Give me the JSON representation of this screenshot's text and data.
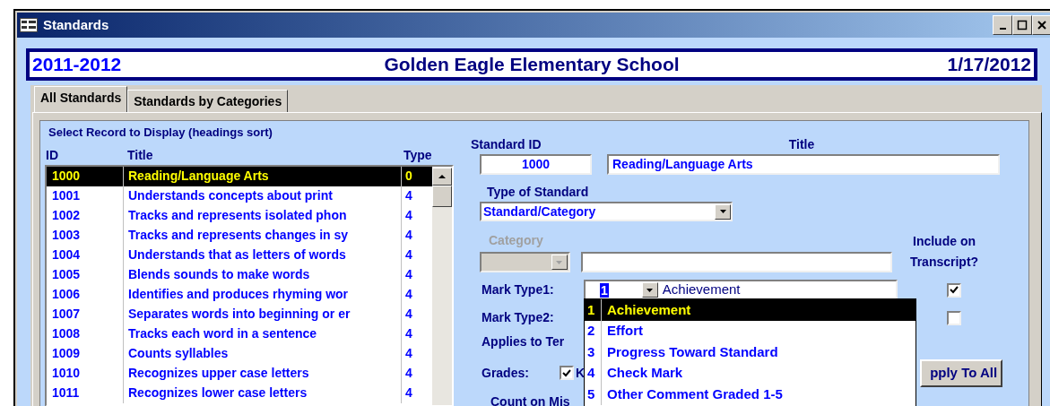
{
  "window": {
    "title": "Standards"
  },
  "header": {
    "year": "2011-2012",
    "school": "Golden Eagle Elementary School",
    "date": "1/17/2012"
  },
  "tabs": [
    {
      "label": "All Standards",
      "selected": true
    },
    {
      "label": "Standards by Categories",
      "selected": false
    }
  ],
  "record_list": {
    "caption": "Select Record to Display (headings sort)",
    "columns": [
      "ID",
      "Title",
      "Type"
    ],
    "rows": [
      {
        "id": "1000",
        "title": "Reading/Language Arts",
        "type": "0",
        "selected": true
      },
      {
        "id": "1001",
        "title": "Understands concepts about print",
        "type": "4",
        "selected": false
      },
      {
        "id": "1002",
        "title": "Tracks and represents isolated phon",
        "type": "4",
        "selected": false
      },
      {
        "id": "1003",
        "title": "Tracks and represents changes in sy",
        "type": "4",
        "selected": false
      },
      {
        "id": "1004",
        "title": "Understands that as letters of words",
        "type": "4",
        "selected": false
      },
      {
        "id": "1005",
        "title": "Blends sounds to make words",
        "type": "4",
        "selected": false
      },
      {
        "id": "1006",
        "title": "Identifies and produces rhyming wor",
        "type": "4",
        "selected": false
      },
      {
        "id": "1007",
        "title": "Separates words into beginning or er",
        "type": "4",
        "selected": false
      },
      {
        "id": "1008",
        "title": "Tracks each word in a sentence",
        "type": "4",
        "selected": false
      },
      {
        "id": "1009",
        "title": "Counts syllables",
        "type": "4",
        "selected": false
      },
      {
        "id": "1010",
        "title": "Recognizes upper case letters",
        "type": "4",
        "selected": false
      },
      {
        "id": "1011",
        "title": "Recognizes lower case letters",
        "type": "4",
        "selected": false
      }
    ]
  },
  "form": {
    "standard_id": {
      "label": "Standard ID",
      "value": "1000"
    },
    "title": {
      "label": "Title",
      "value": "Reading/Language Arts"
    },
    "type_of_standard": {
      "label": "Type of Standard",
      "value": "Standard/Category"
    },
    "category": {
      "label": "Category",
      "disabled": true
    },
    "include_label": "Include on Transcript?",
    "mark_type1": {
      "label": "Mark Type1:",
      "code": "1",
      "name": "Achievement",
      "include": true
    },
    "mark_type2": {
      "label": "Mark Type2:",
      "include": false
    },
    "applies_label": "Applies to Ter",
    "grades": {
      "label": "Grades:",
      "items": [
        {
          "label": "K",
          "checked": true
        }
      ]
    },
    "apply_button": "pply To All",
    "count_label": "Count on Mis"
  },
  "mark_type_dropdown": [
    {
      "code": "1",
      "name": "Achievement",
      "selected": true
    },
    {
      "code": "2",
      "name": "Effort",
      "selected": false
    },
    {
      "code": "3",
      "name": "Progress Toward Standard",
      "selected": false
    },
    {
      "code": "4",
      "name": "Check Mark",
      "selected": false
    },
    {
      "code": "5",
      "name": "Other Comment Graded 1-5",
      "selected": false
    }
  ]
}
